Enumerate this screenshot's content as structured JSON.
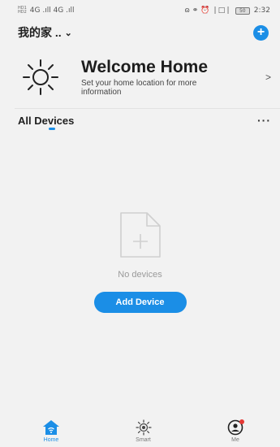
{
  "status_bar": {
    "left_sim_top": "HD1",
    "left_sim_bottom": "HD2",
    "left_signal": "4G .ıll 4G .ıll",
    "right_icons": "ɷ ⚭ ⏰ ❘□❘",
    "battery": "50",
    "time": "2:32"
  },
  "header": {
    "home_name": "我的家 ..",
    "chevron": "⌄",
    "add_symbol": "+"
  },
  "welcome": {
    "title": "Welcome Home",
    "subtitle": "Set your home location for more information",
    "arrow": ">"
  },
  "devices": {
    "title": "All Devices",
    "more": "···",
    "empty_text": "No devices",
    "add_button": "Add Device"
  },
  "tabs": [
    {
      "label": "Home",
      "icon": "home-icon",
      "active": true
    },
    {
      "label": "Smart",
      "icon": "smart-sun-icon",
      "active": false
    },
    {
      "label": "Me",
      "icon": "profile-icon",
      "active": false
    }
  ],
  "colors": {
    "accent": "#1b8ee6",
    "background": "#f2f2f2",
    "badge": "#e53935"
  }
}
